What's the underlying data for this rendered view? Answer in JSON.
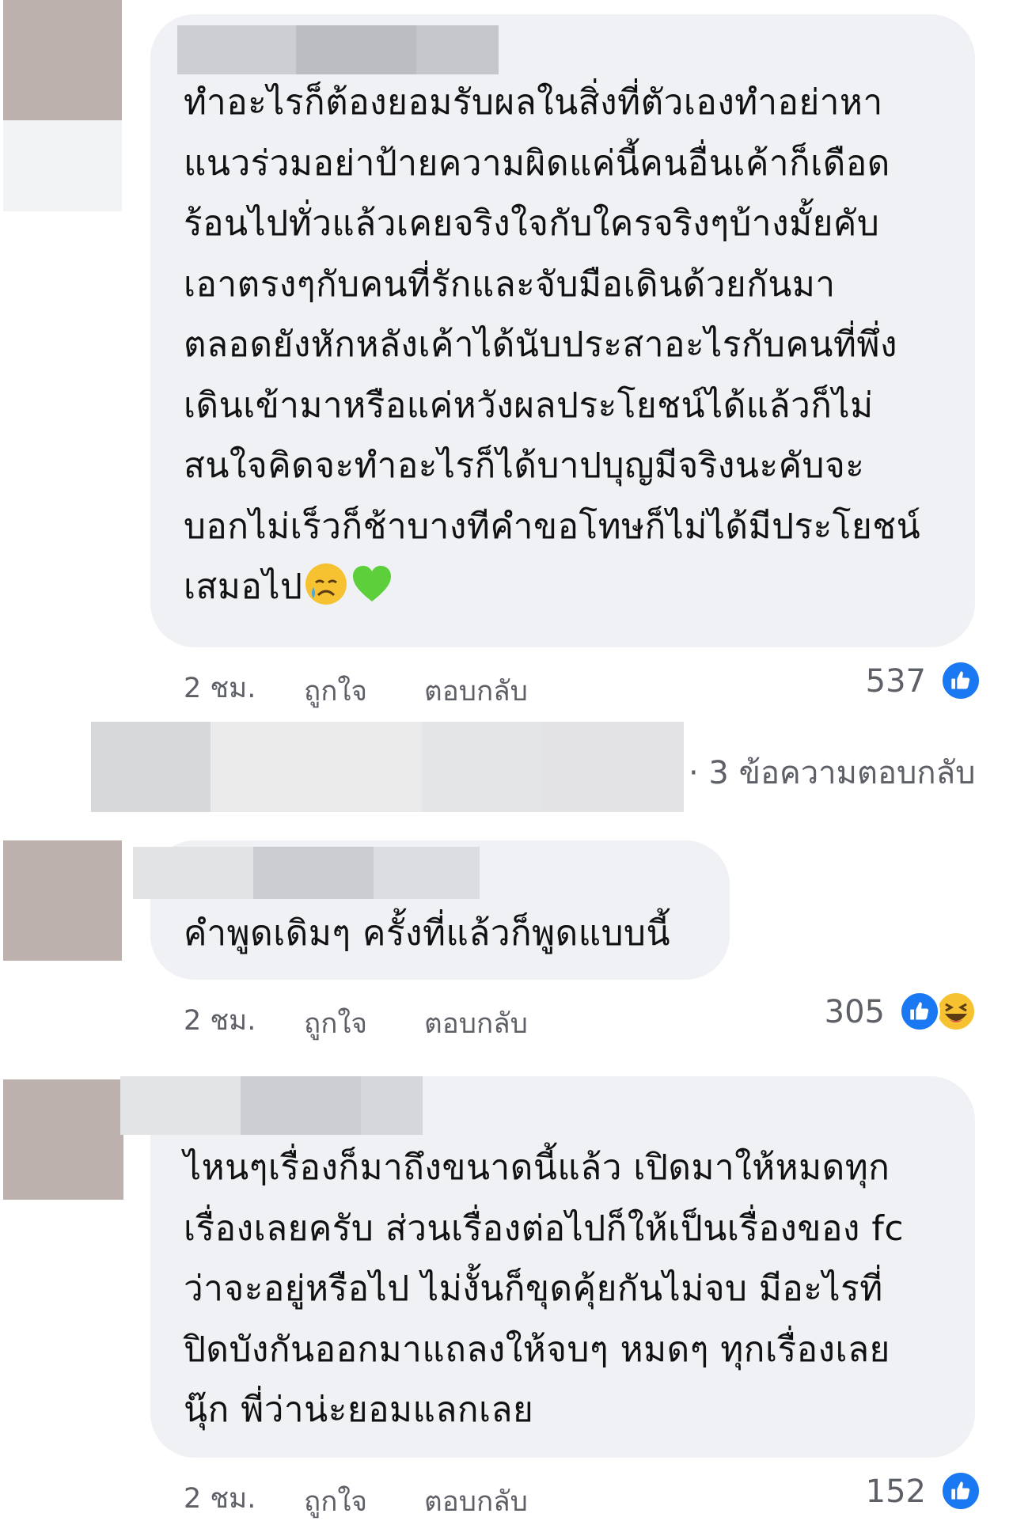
{
  "comments": [
    {
      "text": "ทำอะไรก็ต้องยอมรับผลในสิ่งที่ตัวเองทำอย่าหา\nแนวร่วมอย่าป้ายความผิดแค่นี้คนอื่นเค้าก็เดือด\nร้อนไปทั่วแล้วเคยจริงใจกับใครจริงๆบ้างมั้ยคับ\nเอาตรงๆกับคนที่รักและจับมือเดินด้วยกันมา\nตลอดยังหักหลังเค้าได้นับประสาอะไรกับคนที่พึ่ง\nเดินเข้ามาหรือแค่หวังผลประโยชน์ได้แล้วก็ไม่\nสนใจคิดจะทำอะไรก็ได้บาปบุญมีจริงนะคับจะ\nบอกไม่เร็วก็ช้าบางทีคำขอโทษก็ไม่ได้มีประโยชน์\nเสมอไป",
      "emoji": [
        "sad-tear-emoji",
        "green-heart-emoji"
      ],
      "time": "2 ชม.",
      "like_label": "ถูกใจ",
      "reply_label": "ตอบกลับ",
      "reaction_count": "537",
      "reactions": [
        "like"
      ]
    },
    {
      "text": "คำพูดเดิมๆ ครั้งที่แล้วก็พูดแบบนี้",
      "time": "2 ชม.",
      "like_label": "ถูกใจ",
      "reply_label": "ตอบกลับ",
      "reaction_count": "305",
      "reactions": [
        "like",
        "haha"
      ]
    },
    {
      "text": "ไหนๆเรื่องก็มาถึงขนาดนี้แล้ว เปิดมาให้หมดทุก\nเรื่องเลยครับ  ส่วนเรื่องต่อไปก็ให้เป็นเรื่องของ fc\nว่าจะอยู่หรือไป ไม่งั้นก็ขุดคุ้ยกันไม่จบ มีอะไรที่\nปิดบังกันออกมาแถลงให้จบๆ หมดๆ ทุกเรื่องเลย\nนุ๊ก พี่ว่าน่ะยอมแลกเลย",
      "time": "2 ชม.",
      "like_label": "ถูกใจ",
      "reply_label": "ตอบกลับ",
      "reaction_count": "152",
      "reactions": [
        "like"
      ]
    }
  ],
  "replies_link": "· 3 ข้อความตอบกลับ",
  "colors": {
    "bubble": "#eff1f4",
    "meta_text": "#5e6067",
    "like_blue": "#1a78f2",
    "haha_yellow": "#f6c232",
    "avatar_blur": "#bcb1ad"
  }
}
